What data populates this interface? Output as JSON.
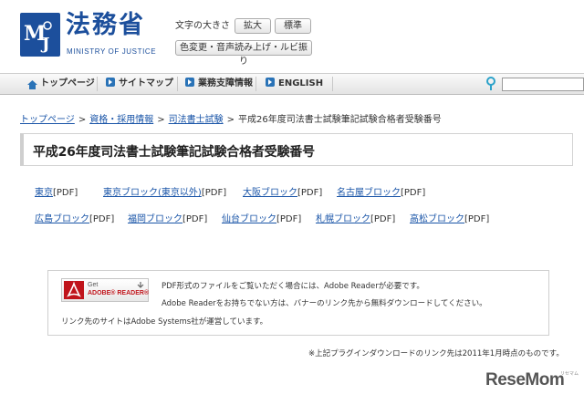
{
  "header": {
    "logo_name": "法務省",
    "logo_sub": "MINISTRY OF JUSTICE",
    "font_size_label": "文字の大きさ",
    "btn_large": "拡大",
    "btn_standard": "標準",
    "btn_accessibility": "色変更・音声読み上げ・ルビ振り",
    "brand_color": "#1c4f9c"
  },
  "nav": {
    "items": [
      {
        "label": "トップページ",
        "icon": "home-icon"
      },
      {
        "label": "サイトマップ",
        "icon": "arrow-square-icon"
      },
      {
        "label": "業務支障情報",
        "icon": "arrow-square-icon"
      },
      {
        "label": "ENGLISH",
        "icon": "arrow-square-icon"
      }
    ],
    "search_icon": "search-icon",
    "search_value": ""
  },
  "breadcrumb": {
    "items": [
      "トップページ",
      "資格・採用情報",
      "司法書士試験"
    ],
    "separator": ">",
    "current": "平成26年度司法書士試験筆記試験合格者受験番号"
  },
  "title": "平成26年度司法書士試験筆記試験合格者受験番号",
  "links": [
    {
      "label": "東京",
      "suffix": "[PDF]"
    },
    {
      "label": "東京ブロック(東京以外)",
      "suffix": "[PDF]"
    },
    {
      "label": "大阪ブロック",
      "suffix": "[PDF]"
    },
    {
      "label": "名古屋ブロック",
      "suffix": "[PDF]"
    },
    {
      "label": "広島ブロック",
      "suffix": "[PDF]"
    },
    {
      "label": "福岡ブロック",
      "suffix": "[PDF]"
    },
    {
      "label": "仙台ブロック",
      "suffix": "[PDF]"
    },
    {
      "label": "札幌ブロック",
      "suffix": "[PDF]"
    },
    {
      "label": "高松ブロック",
      "suffix": "[PDF]"
    }
  ],
  "adobe": {
    "banner_get": "Get",
    "banner_reader": "ADOBE® READER®",
    "line1": "PDF形式のファイルをご覧いただく場合には、Adobe Readerが必要です。",
    "line2": "Adobe Readerをお持ちでない方は、バナーのリンク先から無料ダウンロードしてください。",
    "line3": "リンク先のサイトはAdobe Systems社が運営しています。"
  },
  "note": "※上記プラグインダウンロードのリンク先は2011年1月時点のものです。",
  "watermark": {
    "text": "ReseMom",
    "sub": "リセマム"
  }
}
